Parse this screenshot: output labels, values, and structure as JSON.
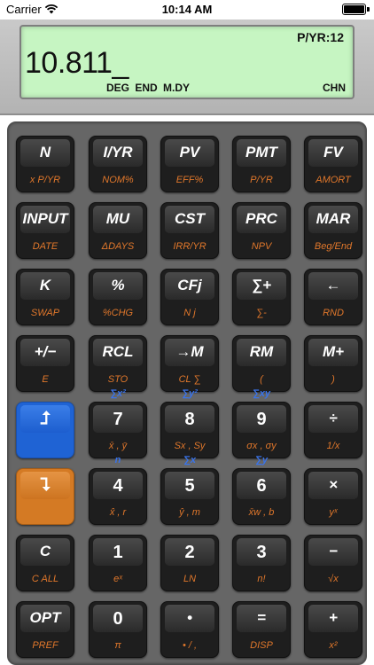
{
  "statusbar": {
    "carrier": "Carrier",
    "time": "10:14 AM"
  },
  "display": {
    "pyr": "P/YR:12",
    "value": "10.811_",
    "status": "DEG END M.DY",
    "mode": "CHN"
  },
  "colors": {
    "lcd": "#c6f5c2",
    "shift_blue": "#1f63d4",
    "shift_orange": "#d47a24",
    "sub_label": "#e0772b",
    "blue_label": "#3a73e8"
  },
  "keys": [
    {
      "main": "N",
      "sub": "x P/YR"
    },
    {
      "main": "I/YR",
      "sub": "NOM%"
    },
    {
      "main": "PV",
      "sub": "EFF%"
    },
    {
      "main": "PMT",
      "sub": "P/YR"
    },
    {
      "main": "FV",
      "sub": "AMORT"
    },
    {
      "main": "INPUT",
      "sub": "DATE"
    },
    {
      "main": "MU",
      "sub": "ΔDAYS"
    },
    {
      "main": "CST",
      "sub": "IRR/YR"
    },
    {
      "main": "PRC",
      "sub": "NPV"
    },
    {
      "main": "MAR",
      "sub": "Beg/End"
    },
    {
      "main": "K",
      "sub": "SWAP"
    },
    {
      "main": "%",
      "sub": "%CHG"
    },
    {
      "main": "CFj",
      "sub": "N j"
    },
    {
      "main": "∑+",
      "sub": "∑-"
    },
    {
      "main": "←",
      "sub": "RND"
    },
    {
      "main": "+/−",
      "sub": "E"
    },
    {
      "main": "RCL",
      "sub": "STO"
    },
    {
      "main": "→M",
      "sub": "CL ∑"
    },
    {
      "main": "RM",
      "sub": "("
    },
    {
      "main": "M+",
      "sub": ")"
    },
    {
      "main": "",
      "sub": "",
      "glyph": "⮥"
    },
    {
      "main": "7",
      "sub": "x̄ , ȳ"
    },
    {
      "main": "8",
      "sub": "Sx , Sy"
    },
    {
      "main": "9",
      "sub": "σx , σy"
    },
    {
      "main": "÷",
      "sub": "1/x"
    },
    {
      "main": "",
      "sub": "",
      "glyph": "⮧"
    },
    {
      "main": "4",
      "sub": "x̂ , r"
    },
    {
      "main": "5",
      "sub": "ŷ , m"
    },
    {
      "main": "6",
      "sub": "x̄w , b"
    },
    {
      "main": "×",
      "sub": "yˣ"
    },
    {
      "main": "C",
      "sub": "C ALL"
    },
    {
      "main": "1",
      "sub": "eˣ"
    },
    {
      "main": "2",
      "sub": "LN"
    },
    {
      "main": "3",
      "sub": "n!"
    },
    {
      "main": "−",
      "sub": "√x"
    },
    {
      "main": "OPT",
      "sub": "PREF"
    },
    {
      "main": "0",
      "sub": "π"
    },
    {
      "main": "•",
      "sub": "• / ,"
    },
    {
      "main": "=",
      "sub": "DISP"
    },
    {
      "main": "+",
      "sub": "x²"
    }
  ],
  "blue_labels": {
    "row5": [
      "∑x²",
      "∑y²",
      "∑xy"
    ],
    "row6": [
      "n",
      "∑x",
      "∑y"
    ]
  }
}
